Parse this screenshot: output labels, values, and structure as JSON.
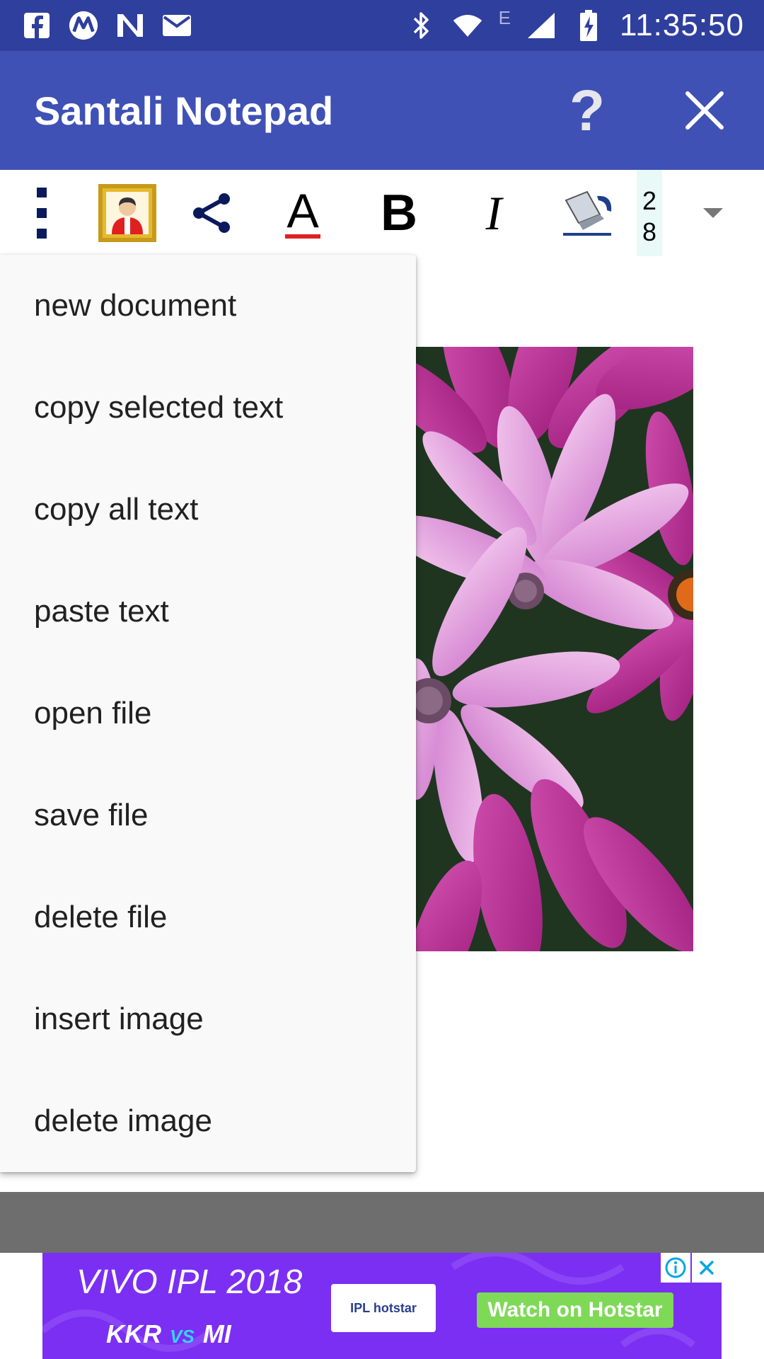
{
  "status_bar": {
    "time": "11:35:50",
    "network_label": "E",
    "left_icons": [
      "facebook-icon",
      "motorola-icon",
      "n-app-icon",
      "mail-icon"
    ],
    "right_icons": [
      "bluetooth-icon",
      "wifi-icon",
      "signal-icon",
      "battery-icon"
    ]
  },
  "app_bar": {
    "title": "Santali Notepad",
    "help_label": "?",
    "close_icon": "close-icon"
  },
  "toolbar": {
    "icons": [
      "overflow-menu-icon",
      "portrait-icon",
      "share-icon",
      "text-color-icon",
      "bold-icon",
      "italic-icon",
      "fill-color-icon",
      "dropdown-icon"
    ],
    "text_color_glyph": "A",
    "bold_glyph": "B",
    "italic_glyph": "I",
    "font_size_digit1": "2",
    "font_size_digit2": "8"
  },
  "menu": {
    "items": [
      "new document",
      "copy selected text",
      "copy all text",
      "paste text",
      "open file",
      "save file",
      "delete file",
      "insert image",
      "delete image"
    ]
  },
  "ad": {
    "title": "VIVO IPL 2018",
    "team_left": "KKR",
    "vs": "VS",
    "team_right": "MI",
    "logo_text": "IPL hotstar",
    "cta": "Watch on Hotstar",
    "info_icon": "info-icon",
    "close_icon": "close-icon"
  },
  "colors": {
    "status_bar": "#2f3f9e",
    "app_bar": "#3f51b5",
    "menu_bg": "#f9f9f9",
    "ad_bg": "#7b2ff2",
    "cta": "#7ed957"
  }
}
